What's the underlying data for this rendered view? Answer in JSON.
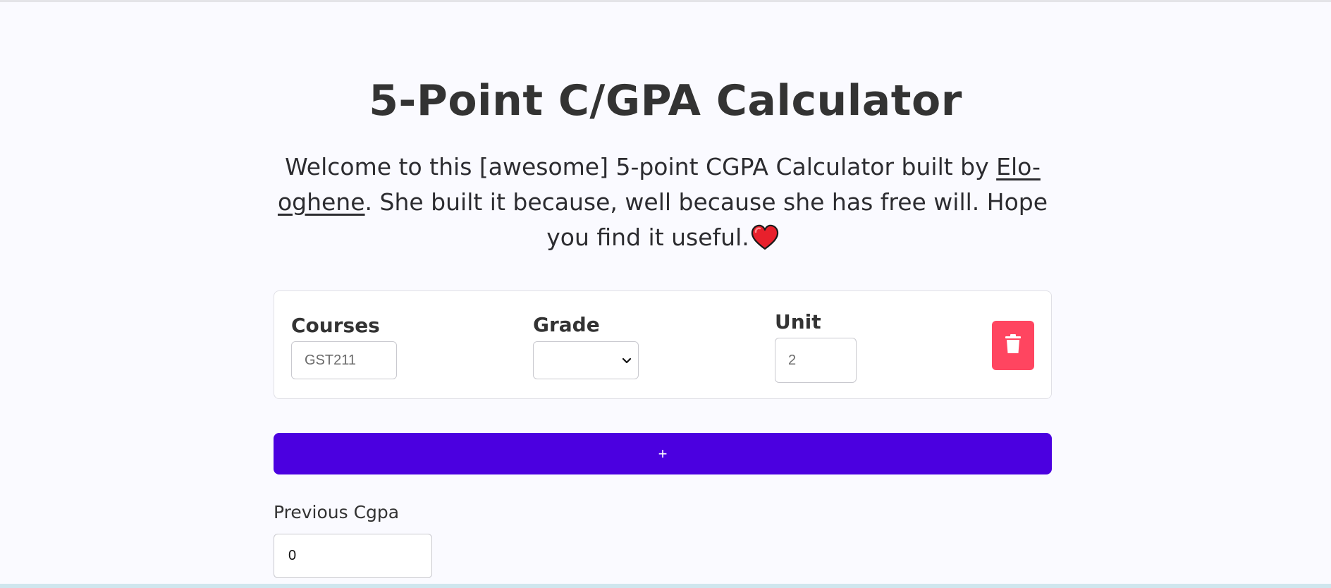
{
  "page": {
    "title": "5-Point C/GPA Calculator",
    "intro_before_link": "Welcome to this [awesome] 5-point CGPA Calculator built by ",
    "author_link": "Elo-oghene",
    "intro_after_link": ". She built it because, well because she has free will. Hope you find it useful.",
    "heart_icon": "heart-icon"
  },
  "course_row": {
    "courses_label": "Courses",
    "course_value": "GST211",
    "grade_label": "Grade",
    "grade_selected": "",
    "unit_label": "Unit",
    "unit_value": "2",
    "delete_icon": "trash-icon"
  },
  "actions": {
    "add_label": "+"
  },
  "previous": {
    "label": "Previous Cgpa",
    "value": "0"
  },
  "colors": {
    "background": "#fafaff",
    "primary": "#4b00e0",
    "danger": "#ff4560",
    "heart": "#e8202c"
  }
}
